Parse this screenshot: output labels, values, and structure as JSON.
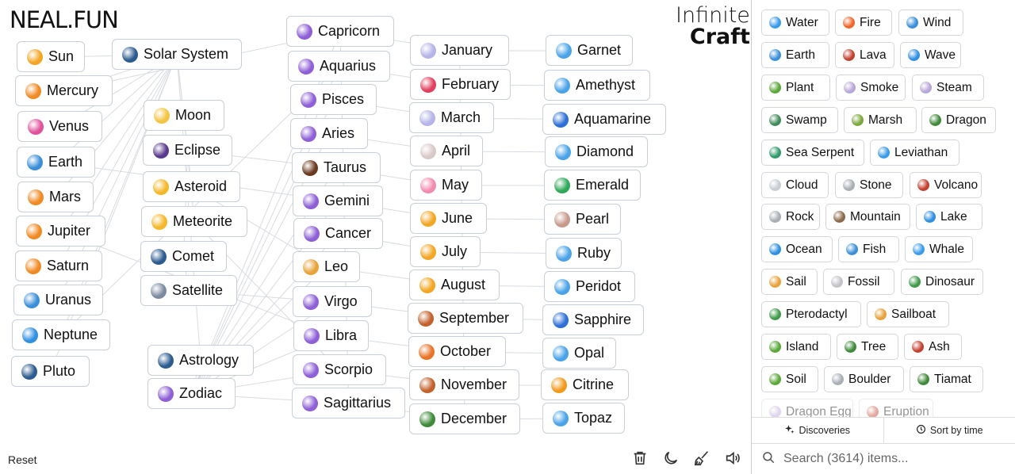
{
  "logo": "NEAL.FUN",
  "brand": {
    "line1": "Infinite",
    "line2": "Craft"
  },
  "reset_label": "Reset",
  "toolbar": {
    "icons": [
      "trash-icon",
      "moon-icon",
      "broom-icon",
      "speaker-icon"
    ]
  },
  "canvas": {
    "elements": [
      {
        "text": "Sun",
        "icon": "sun-icon",
        "color": "#f2a623"
      },
      {
        "text": "Mercury",
        "icon": "comet-icon",
        "color": "#f08a24"
      },
      {
        "text": "Venus",
        "icon": "venus-icon",
        "color": "#e0529c"
      },
      {
        "text": "Earth",
        "icon": "earth-icon",
        "color": "#3a8fd8"
      },
      {
        "text": "Mars",
        "icon": "comet-icon",
        "color": "#f08a24"
      },
      {
        "text": "Jupiter",
        "icon": "comet-icon",
        "color": "#f08a24"
      },
      {
        "text": "Saturn",
        "icon": "comet-icon",
        "color": "#f08a24"
      },
      {
        "text": "Uranus",
        "icon": "earth-icon",
        "color": "#3a8fd8"
      },
      {
        "text": "Neptune",
        "icon": "wave-icon",
        "color": "#2f8fe0"
      },
      {
        "text": "Pluto",
        "icon": "milky-way-icon",
        "color": "#2c5b8f"
      },
      {
        "text": "Solar System",
        "icon": "milky-way-icon",
        "color": "#2c5b8f"
      },
      {
        "text": "Moon",
        "icon": "crescent-moon-icon",
        "color": "#f4c542"
      },
      {
        "text": "Eclipse",
        "icon": "new-moon-icon",
        "color": "#5a3a8c"
      },
      {
        "text": "Asteroid",
        "icon": "dizzy-icon",
        "color": "#f4b82a"
      },
      {
        "text": "Meteorite",
        "icon": "dizzy-icon",
        "color": "#f4b82a"
      },
      {
        "text": "Comet",
        "icon": "milky-way-icon",
        "color": "#2c5b8f"
      },
      {
        "text": "Satellite",
        "icon": "satellite-icon",
        "color": "#7c8aa0"
      },
      {
        "text": "Astrology",
        "icon": "milky-way-icon",
        "color": "#2c5b8f"
      },
      {
        "text": "Zodiac",
        "icon": "aries-icon",
        "color": "#8e5fd6"
      },
      {
        "text": "Capricorn",
        "icon": "capricorn-icon",
        "color": "#8e5fd6"
      },
      {
        "text": "Aquarius",
        "icon": "aquarius-icon",
        "color": "#8e5fd6"
      },
      {
        "text": "Pisces",
        "icon": "pisces-icon",
        "color": "#8e5fd6"
      },
      {
        "text": "Aries",
        "icon": "aries-icon",
        "color": "#8e5fd6"
      },
      {
        "text": "Taurus",
        "icon": "ox-icon",
        "color": "#6b3a1e"
      },
      {
        "text": "Gemini",
        "icon": "gemini-icon",
        "color": "#8e5fd6"
      },
      {
        "text": "Cancer",
        "icon": "cancer-icon",
        "color": "#8e5fd6"
      },
      {
        "text": "Leo",
        "icon": "lion-icon",
        "color": "#e8a23a"
      },
      {
        "text": "Virgo",
        "icon": "virgo-icon",
        "color": "#8e5fd6"
      },
      {
        "text": "Libra",
        "icon": "libra-icon",
        "color": "#8e5fd6"
      },
      {
        "text": "Scorpio",
        "icon": "scorpio-icon",
        "color": "#8e5fd6"
      },
      {
        "text": "Sagittarius",
        "icon": "sagittarius-icon",
        "color": "#8e5fd6"
      },
      {
        "text": "January",
        "icon": "calendar-icon",
        "color": "#b5b3e8"
      },
      {
        "text": "February",
        "icon": "heart-icon",
        "color": "#e0405e"
      },
      {
        "text": "March",
        "icon": "calendar-icon",
        "color": "#b5b3e8"
      },
      {
        "text": "April",
        "icon": "rabbit-icon",
        "color": "#d9c8c8"
      },
      {
        "text": "May",
        "icon": "blossom-icon",
        "color": "#f28bb0"
      },
      {
        "text": "June",
        "icon": "smiling-sun-icon",
        "color": "#f2a623"
      },
      {
        "text": "July",
        "icon": "smiling-sun-icon",
        "color": "#f2a623"
      },
      {
        "text": "August",
        "icon": "smiling-sun-icon",
        "color": "#f2a623"
      },
      {
        "text": "September",
        "icon": "leaves-icon",
        "color": "#c4622d"
      },
      {
        "text": "October",
        "icon": "pumpkin-icon",
        "color": "#e8742a"
      },
      {
        "text": "November",
        "icon": "leaves-icon",
        "color": "#c4622d"
      },
      {
        "text": "December",
        "icon": "christmas-tree-icon",
        "color": "#3e8a3a"
      },
      {
        "text": "Garnet",
        "icon": "gem-icon",
        "color": "#4aa3e8"
      },
      {
        "text": "Amethyst",
        "icon": "gem-icon",
        "color": "#4aa3e8"
      },
      {
        "text": "Aquamarine",
        "icon": "blue-heart-icon",
        "color": "#2d6fd6"
      },
      {
        "text": "Diamond",
        "icon": "gem-icon",
        "color": "#4aa3e8"
      },
      {
        "text": "Emerald",
        "icon": "green-heart-icon",
        "color": "#2fa85a"
      },
      {
        "text": "Pearl",
        "icon": "oyster-icon",
        "color": "#c79a8c"
      },
      {
        "text": "Ruby",
        "icon": "gem-icon",
        "color": "#4aa3e8"
      },
      {
        "text": "Peridot",
        "icon": "gem-icon",
        "color": "#4aa3e8"
      },
      {
        "text": "Sapphire",
        "icon": "blue-heart-icon",
        "color": "#2d6fd6"
      },
      {
        "text": "Opal",
        "icon": "gem-icon",
        "color": "#4aa3e8"
      },
      {
        "text": "Citrine",
        "icon": "tangerine-icon",
        "color": "#f29a1e"
      },
      {
        "text": "Topaz",
        "icon": "gem-icon",
        "color": "#4aa3e8"
      }
    ]
  },
  "sidebar": {
    "items": [
      {
        "text": "Water",
        "icon": "droplet-icon",
        "color": "#3a9be8"
      },
      {
        "text": "Fire",
        "icon": "fire-icon",
        "color": "#f0652a"
      },
      {
        "text": "Wind",
        "icon": "wind-icon",
        "color": "#3a8fd8"
      },
      {
        "text": "Earth",
        "icon": "earth-icon",
        "color": "#3a8fd8"
      },
      {
        "text": "Lava",
        "icon": "volcano-icon",
        "color": "#c2412f"
      },
      {
        "text": "Wave",
        "icon": "wave-icon",
        "color": "#2f8fe0"
      },
      {
        "text": "Plant",
        "icon": "seedling-icon",
        "color": "#5aa83a"
      },
      {
        "text": "Smoke",
        "icon": "sparkle-icon",
        "color": "#b9a6d8"
      },
      {
        "text": "Steam",
        "icon": "sparkle-icon",
        "color": "#b9a6d8"
      },
      {
        "text": "Swamp",
        "icon": "lizard-icon",
        "color": "#3f8a5a"
      },
      {
        "text": "Marsh",
        "icon": "reed-icon",
        "color": "#7aa83a"
      },
      {
        "text": "Dragon",
        "icon": "dragon-icon",
        "color": "#3f8a3a"
      },
      {
        "text": "Sea Serpent",
        "icon": "serpent-icon",
        "color": "#2f9a6a"
      },
      {
        "text": "Leviathan",
        "icon": "whale-icon",
        "color": "#3a9be8"
      },
      {
        "text": "Cloud",
        "icon": "cloud-icon",
        "color": "#c8cdd4"
      },
      {
        "text": "Stone",
        "icon": "rock-icon",
        "color": "#a9aeb5"
      },
      {
        "text": "Volcano",
        "icon": "volcano-icon",
        "color": "#c2412f"
      },
      {
        "text": "Rock",
        "icon": "rock-icon",
        "color": "#a9aeb5"
      },
      {
        "text": "Mountain",
        "icon": "mountain-icon",
        "color": "#8a6a4a"
      },
      {
        "text": "Lake",
        "icon": "wave-icon",
        "color": "#2f8fe0"
      },
      {
        "text": "Ocean",
        "icon": "wave-icon",
        "color": "#2f8fe0"
      },
      {
        "text": "Fish",
        "icon": "fish-icon",
        "color": "#3a8fd8"
      },
      {
        "text": "Whale",
        "icon": "whale-icon",
        "color": "#3a9be8"
      },
      {
        "text": "Sail",
        "icon": "sailboat-icon",
        "color": "#e8a23a"
      },
      {
        "text": "Fossil",
        "icon": "bone-icon",
        "color": "#c2c2c8"
      },
      {
        "text": "Dinosaur",
        "icon": "sauropod-icon",
        "color": "#3f9a4a"
      },
      {
        "text": "Pterodactyl",
        "icon": "sauropod-icon",
        "color": "#3f9a4a"
      },
      {
        "text": "Sailboat",
        "icon": "sailboat-icon",
        "color": "#e8a23a"
      },
      {
        "text": "Island",
        "icon": "palm-tree-icon",
        "color": "#5aa83a"
      },
      {
        "text": "Tree",
        "icon": "tree-icon",
        "color": "#3e8a3a"
      },
      {
        "text": "Ash",
        "icon": "volcano-icon",
        "color": "#c2412f"
      },
      {
        "text": "Soil",
        "icon": "seedling-icon",
        "color": "#5aa83a"
      },
      {
        "text": "Boulder",
        "icon": "rock-icon",
        "color": "#a9aeb5"
      },
      {
        "text": "Tiamat",
        "icon": "dragon-icon",
        "color": "#3f8a3a"
      },
      {
        "text": "Dragon Egg",
        "icon": "sparkle-icon",
        "color": "#b9a6d8"
      },
      {
        "text": "Eruption",
        "icon": "volcano-icon",
        "color": "#c2412f"
      }
    ],
    "tabs": [
      {
        "label": "Discoveries",
        "icon": "sparkles-icon"
      },
      {
        "label": "Sort by time",
        "icon": "clock-icon"
      }
    ],
    "search_placeholder": "Search (3614) items..."
  }
}
